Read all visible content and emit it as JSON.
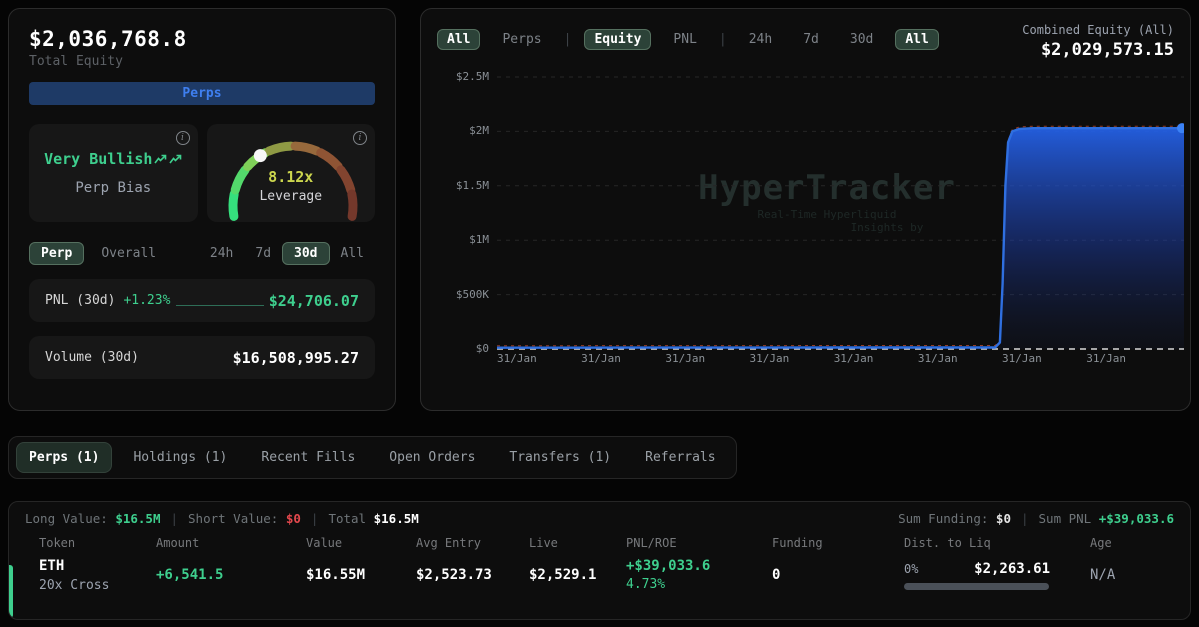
{
  "colors": {
    "accent_green": "#3ecf8e",
    "accent_blue": "#3b82f6",
    "accent_red": "#e5484d",
    "leverage_yellow": "#ccd64e"
  },
  "equity_panel": {
    "total_equity_value": "$2,036,768.8",
    "total_equity_label": "Total Equity",
    "allocation_button_label": "Perps",
    "bias_card": {
      "value": "Very Bullish",
      "label": "Perp Bias"
    },
    "leverage_card": {
      "value": "8.12x",
      "label": "Leverage"
    },
    "scope_tabs": [
      {
        "label": "Perp",
        "selected": true
      },
      {
        "label": "Overall",
        "selected": false
      }
    ],
    "period_tabs": [
      {
        "label": "24h",
        "selected": false
      },
      {
        "label": "7d",
        "selected": false
      },
      {
        "label": "30d",
        "selected": true
      },
      {
        "label": "All",
        "selected": false
      }
    ],
    "pnl_row": {
      "label": "PNL (30d)",
      "percent": "+1.23%",
      "value": "$24,706.07"
    },
    "volume_row": {
      "label": "Volume (30d)",
      "value": "$16,508,995.27"
    }
  },
  "chart_panel": {
    "separator": "|",
    "tabs": [
      {
        "label": "All",
        "selected": true
      },
      {
        "label": "Perps",
        "selected": false
      },
      {
        "label": "Equity",
        "selected": true
      },
      {
        "label": "PNL",
        "selected": false
      },
      {
        "label": "24h",
        "selected": false
      },
      {
        "label": "7d",
        "selected": false
      },
      {
        "label": "30d",
        "selected": false
      },
      {
        "label": "All",
        "selected": true
      }
    ],
    "combined_equity_label": "Combined Equity (All)",
    "combined_equity_value": "$2,029,573.15",
    "watermark_title": "HyperTracker",
    "watermark_sub1": "Real-Time Hyperliquid",
    "watermark_sub2": "Insights by"
  },
  "chart_data": {
    "type": "area",
    "title": "Combined Equity (All)",
    "xlabel": "",
    "ylabel": "",
    "ylim": [
      0,
      2500000
    ],
    "y_tick_labels": [
      "$2.5M",
      "$2M",
      "$1.5M",
      "$1M",
      "$500K",
      "$0"
    ],
    "x_tick_labels": [
      "31/Jan",
      "31/Jan",
      "31/Jan",
      "31/Jan",
      "31/Jan",
      "31/Jan",
      "31/Jan",
      "31/Jan"
    ],
    "grid": true,
    "legend": false,
    "final_value": 2029573.15,
    "line_color": "#2f6fe0",
    "dot_color": "#3b82f6",
    "overlay_dash_color": "#b74a2e",
    "series": [
      {
        "name": "Combined Equity (All)",
        "points": [
          [
            0,
            12000
          ],
          [
            0.1,
            12400
          ],
          [
            0.2,
            12700
          ],
          [
            0.3,
            13000
          ],
          [
            0.4,
            13200
          ],
          [
            0.5,
            13400
          ],
          [
            0.6,
            13500
          ],
          [
            0.7,
            13600
          ],
          [
            0.725,
            13700
          ],
          [
            0.732,
            60000
          ],
          [
            0.736,
            600000
          ],
          [
            0.74,
            1500000
          ],
          [
            0.744,
            1900000
          ],
          [
            0.75,
            2000000
          ],
          [
            0.76,
            2022000
          ],
          [
            0.78,
            2029000
          ],
          [
            0.9,
            2029300
          ],
          [
            1,
            2029573
          ]
        ]
      }
    ]
  },
  "section_tabs": [
    {
      "label": "Perps (1)",
      "selected": true
    },
    {
      "label": "Holdings (1)",
      "selected": false
    },
    {
      "label": "Recent Fills",
      "selected": false
    },
    {
      "label": "Open Orders",
      "selected": false
    },
    {
      "label": "Transfers (1)",
      "selected": false
    },
    {
      "label": "Referrals",
      "selected": false
    }
  ],
  "positions_panel": {
    "summary": {
      "separator": "|",
      "long_label": "Long Value:",
      "long_value": "$16.5M",
      "short_label": "Short Value:",
      "short_value": "$0",
      "total_label": "Total",
      "total_value": "$16.5M",
      "funding_label": "Sum Funding:",
      "funding_value": "$0",
      "pnl_label": "Sum PNL",
      "pnl_value": "+$39,033.6"
    },
    "headers": [
      "Token",
      "Amount",
      "Value",
      "Avg Entry",
      "Live",
      "PNL/ROE",
      "Funding",
      "Dist. to Liq",
      "Age"
    ],
    "row": {
      "token": "ETH",
      "token_sub": "20x Cross",
      "amount": "+6,541.5",
      "value": "$16.55M",
      "avg_entry": "$2,523.73",
      "live": "$2,529.1",
      "pnl": "+$39,033.6",
      "roe": "4.73%",
      "funding": "0",
      "dist_percent": "0%",
      "dist_value": "$2,263.61",
      "age": "N/A"
    }
  }
}
